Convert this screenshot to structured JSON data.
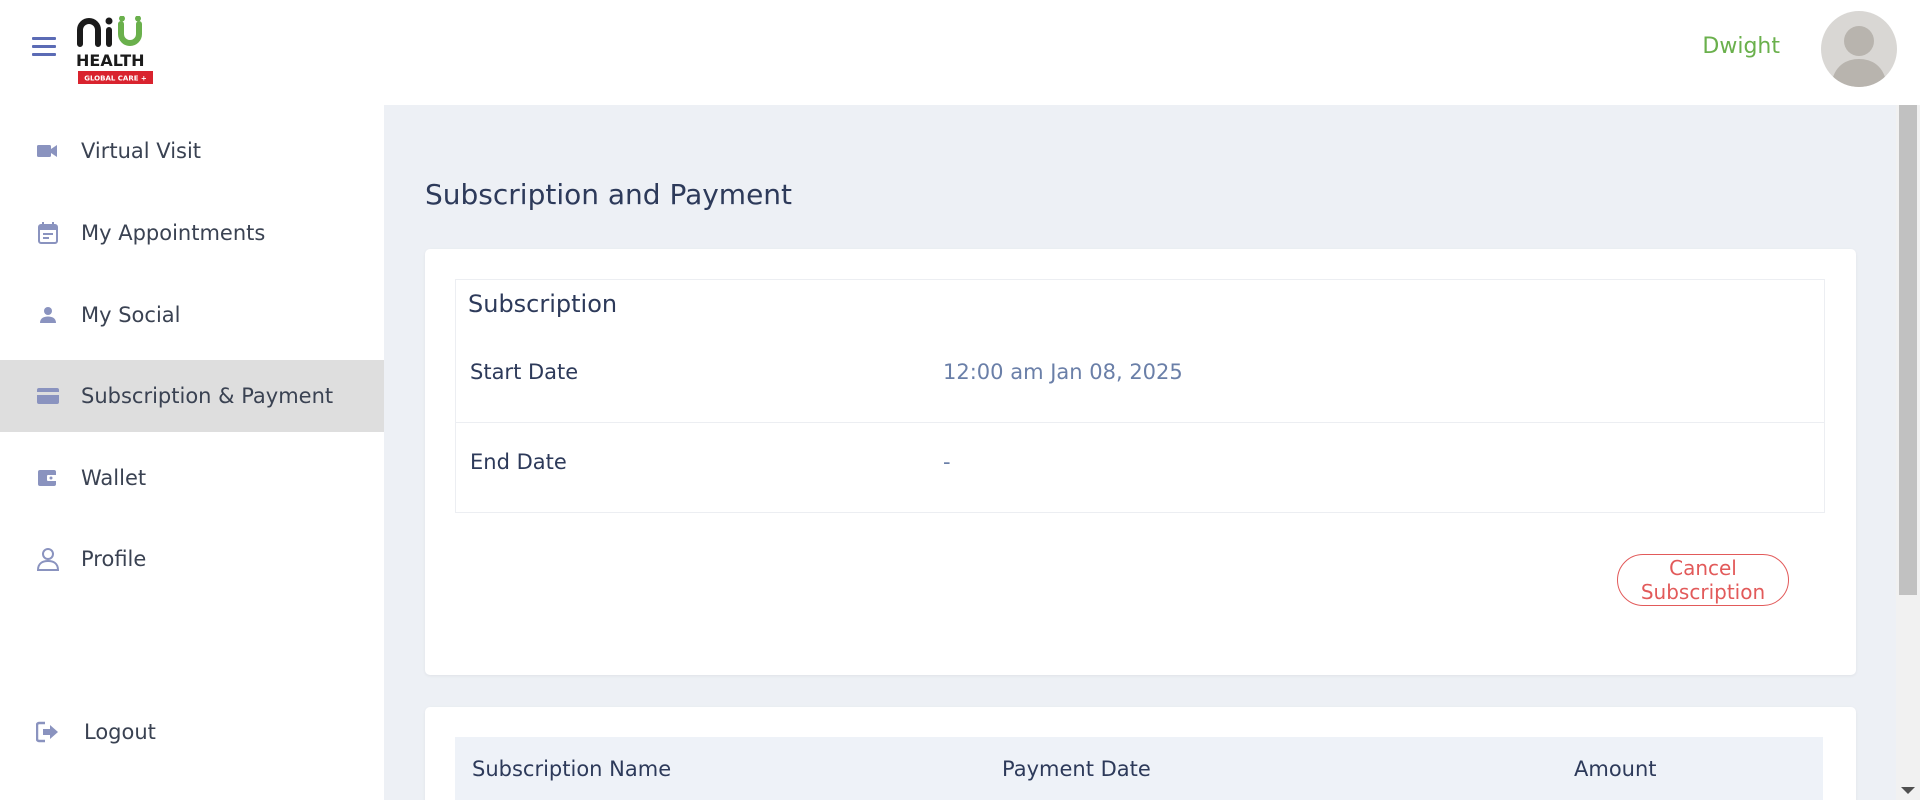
{
  "header": {
    "logo_text": "HEALTH",
    "logo_tagline": "GLOBAL CARE +",
    "username": "Dwight"
  },
  "sidebar": {
    "items": [
      {
        "label": "Virtual Visit",
        "icon": "video-camera-icon"
      },
      {
        "label": "My Appointments",
        "icon": "calendar-icon"
      },
      {
        "label": "My Social",
        "icon": "person-icon"
      },
      {
        "label": "Subscription & Payment",
        "icon": "credit-card-icon",
        "active": true
      },
      {
        "label": "Wallet",
        "icon": "wallet-icon"
      },
      {
        "label": "Profile",
        "icon": "profile-icon"
      }
    ],
    "logout_label": "Logout"
  },
  "main": {
    "page_title": "Subscription and Payment",
    "subscription": {
      "title": "Subscription",
      "start_date_label": "Start Date",
      "start_date_value": "12:00 am Jan 08, 2025",
      "end_date_label": "End Date",
      "end_date_value": "-",
      "cancel_label": "Cancel Subscription"
    },
    "table": {
      "columns": [
        "Subscription Name",
        "Payment Date",
        "Amount"
      ]
    }
  },
  "colors": {
    "accent_green": "#6ab04c",
    "cancel_red": "#e25a5a",
    "nav_icon": "#8a93bf",
    "main_bg": "#edf0f5"
  }
}
